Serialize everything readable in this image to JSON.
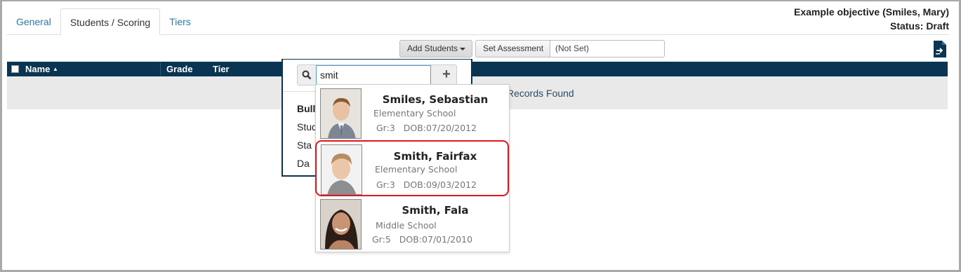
{
  "tabs": [
    {
      "label": "General",
      "active": false
    },
    {
      "label": "Students / Scoring",
      "active": true
    },
    {
      "label": "Tiers",
      "active": false
    }
  ],
  "objective": {
    "title": "Example objective (Smiles, Mary)",
    "status": "Status: Draft"
  },
  "toolbar": {
    "add_students_label": "Add Students",
    "set_assessment_label": "Set Assessment",
    "assessment_value": "(Not Set)",
    "export_icon": "export-icon"
  },
  "table": {
    "columns": [
      "Name",
      "Grade",
      "Tier"
    ],
    "sort_indicator": "▲",
    "empty_message_tail": "Records Found"
  },
  "panel": {
    "search_value": "smit",
    "items": [
      "Bull",
      "Stud",
      "Sta",
      "Da"
    ]
  },
  "results": [
    {
      "name": "Smiles, Sebastian",
      "school": "Elementary School",
      "grade": "Gr:3",
      "dob": "DOB:07/20/2012"
    },
    {
      "name": "Smith, Fairfax",
      "school": "Elementary School",
      "grade": "Gr:3",
      "dob": "DOB:09/03/2012"
    },
    {
      "name": "Smith, Fala",
      "school": "Middle School",
      "grade": "Gr:5",
      "dob": "DOB:07/01/2010"
    }
  ],
  "colors": {
    "header_bg": "#0a3552",
    "tab_link": "#2a7ab0",
    "highlight": "#e0161c"
  }
}
